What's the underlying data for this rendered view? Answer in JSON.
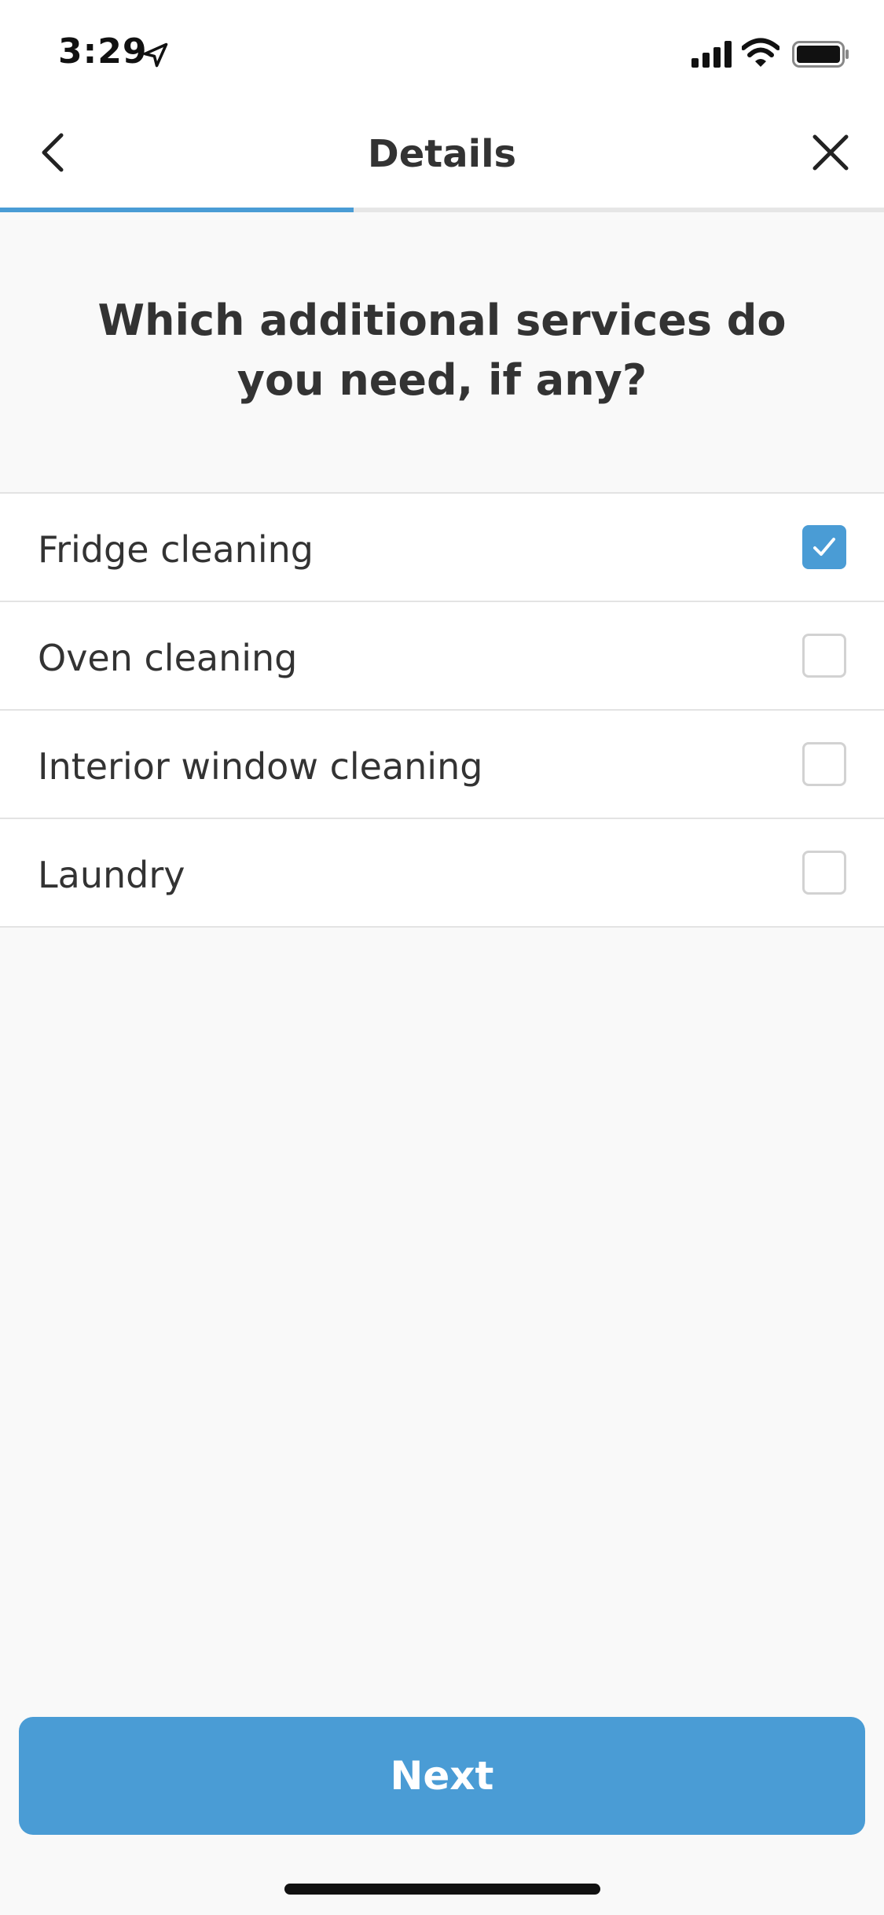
{
  "status_bar": {
    "time": "3:29",
    "icons": [
      "location-arrow-icon",
      "cellular-signal-icon",
      "wifi-icon",
      "battery-icon"
    ]
  },
  "nav": {
    "title": "Details",
    "back_icon": "chevron-left-icon",
    "close_icon": "close-icon",
    "progress_fraction": 0.4
  },
  "question": "Which additional services do you need, if any?",
  "options": [
    {
      "label": "Fridge cleaning",
      "checked": true
    },
    {
      "label": "Oven cleaning",
      "checked": false
    },
    {
      "label": "Interior window cleaning",
      "checked": false
    },
    {
      "label": "Laundry",
      "checked": false
    }
  ],
  "next_button": {
    "label": "Next"
  },
  "colors": {
    "accent": "#4a9cd5",
    "text": "#333333",
    "background": "#f9f9f9"
  }
}
